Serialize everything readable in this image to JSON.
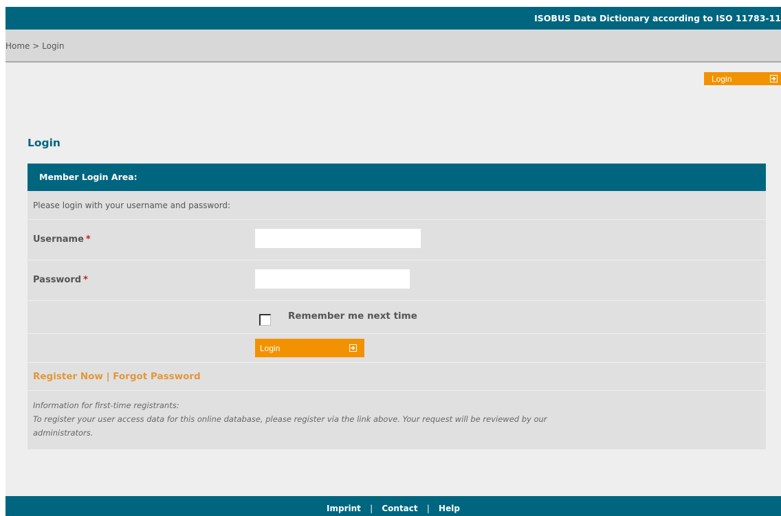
{
  "header": {
    "site_title": "ISOBUS Data Dictionary according to ISO 11783-11"
  },
  "breadcrumb": {
    "text": "Home > Login"
  },
  "top_login_button": {
    "label": "Login",
    "icon": "arrow-right-box-icon"
  },
  "page": {
    "title": "Login"
  },
  "login_panel": {
    "header": "Member Login Area:",
    "intro": "Please login with your username and password:",
    "username_label": "Username",
    "username_value": "",
    "password_label": "Password",
    "password_value": "",
    "required_marker": "*",
    "remember_label": "Remember me next time",
    "remember_checked": false,
    "submit_label": "Login",
    "submit_icon": "arrow-right-box-icon",
    "register_link": "Register Now",
    "link_separator": "|",
    "forgot_link": "Forgot Password",
    "info_line1": "Information for first-time registrants:",
    "info_line2": "To register your user access data for this online database, please register via the link above. Your request will be reviewed by our",
    "info_line3": "administrators."
  },
  "footer": {
    "imprint": "Imprint",
    "contact": "Contact",
    "help": "Help",
    "separator": "|"
  },
  "colors": {
    "brand_teal": "#006680",
    "accent_orange": "#f39200",
    "link_orange": "#e3963a",
    "required_red": "#cc1e1e"
  }
}
